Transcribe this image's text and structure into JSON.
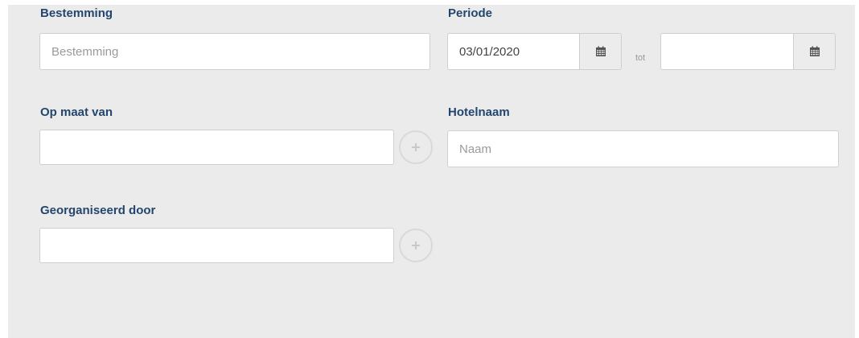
{
  "form": {
    "bestemming": {
      "label": "Bestemming",
      "value": "",
      "placeholder": "Bestemming"
    },
    "periode": {
      "label": "Periode",
      "start_value": "03/01/2020",
      "end_value": "",
      "separator": "tot",
      "calendar_icon": "calendar-icon"
    },
    "op_maat_van": {
      "label": "Op maat van",
      "value": "",
      "add_icon": "plus-icon"
    },
    "hotelnaam": {
      "label": "Hotelnaam",
      "value": "",
      "placeholder": "Naam"
    },
    "georganiseerd_door": {
      "label": "Georganiseerd door",
      "value": "",
      "add_icon": "plus-icon"
    }
  },
  "colors": {
    "label": "#23466e",
    "panel_background": "#ebebeb",
    "input_border": "#cfcfcf",
    "icon": "#555555"
  }
}
